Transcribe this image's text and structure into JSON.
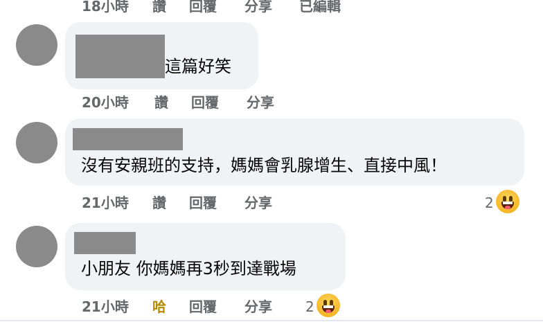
{
  "top_bar": {
    "time": "18小時",
    "like": "讚",
    "reply": "回覆",
    "share": "分享",
    "edited": "已編輯"
  },
  "comments": [
    {
      "text": "這篇好笑",
      "actions": {
        "time": "20小時",
        "like": "讚",
        "reply": "回覆",
        "share": "分享"
      }
    },
    {
      "text": "沒有安親班的支持，媽媽會乳腺增生、直接中風！",
      "actions": {
        "time": "21小時",
        "like": "讚",
        "reply": "回覆",
        "share": "分享"
      },
      "reaction": {
        "count": "2",
        "icon": "grinning-face-icon"
      }
    },
    {
      "text": "小朋友 你媽媽再3秒到達戰場",
      "actions": {
        "time": "21小時",
        "like": "哈",
        "reply": "回覆",
        "share": "分享"
      },
      "reaction": {
        "count": "2",
        "icon": "grinning-face-icon"
      }
    }
  ],
  "colors": {
    "bubble": "#f0f2f5",
    "action_text": "#65676b",
    "haha_text": "#b58a00",
    "redaction": "#8a8a8a"
  }
}
